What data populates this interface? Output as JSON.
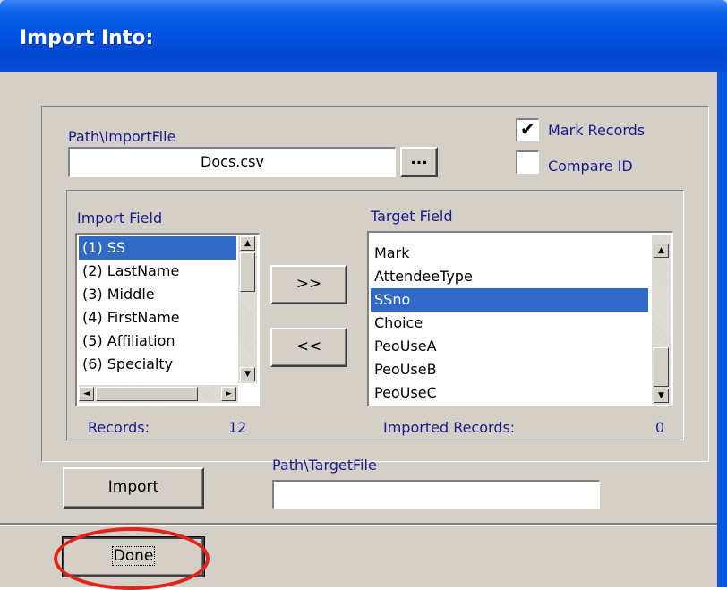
{
  "window": {
    "title": "Import Into:"
  },
  "path_import": {
    "label": "Path\\ImportFile",
    "value": "Docs.csv",
    "browse_label": "..."
  },
  "options": {
    "mark_records": {
      "label": "Mark Records",
      "checked": true,
      "check_glyph": "✔"
    },
    "compare_id": {
      "label": "Compare ID",
      "checked": false
    }
  },
  "import_field": {
    "label": "Import Field",
    "items": [
      "(1) SS",
      "(2) LastName",
      "(3) Middle",
      "(4) FirstName",
      "(5) Affiliation",
      "(6) Specialty"
    ],
    "selected_index": 0,
    "records_label": "Records:",
    "records_value": "12"
  },
  "target_field": {
    "label": "Target Field",
    "items": [
      "Mark",
      "AttendeeType",
      "SSno",
      "Choice",
      "PeoUseA",
      "PeoUseB",
      "PeoUseC"
    ],
    "selected_index": 2,
    "imported_label": "Imported Records:",
    "imported_value": "0"
  },
  "buttons": {
    "add": ">>",
    "remove": "<<",
    "import": "Import",
    "done": "Done"
  },
  "path_target": {
    "label": "Path\\TargetFile",
    "value": ""
  },
  "scroll_arrows": {
    "up": "▲",
    "down": "▼",
    "left": "◄",
    "right": "►"
  },
  "colors": {
    "selection": "#316ac5",
    "highlight_circle": "#e2231a",
    "titlebar": "#0054e3",
    "dialog": "#d4d0c8"
  }
}
